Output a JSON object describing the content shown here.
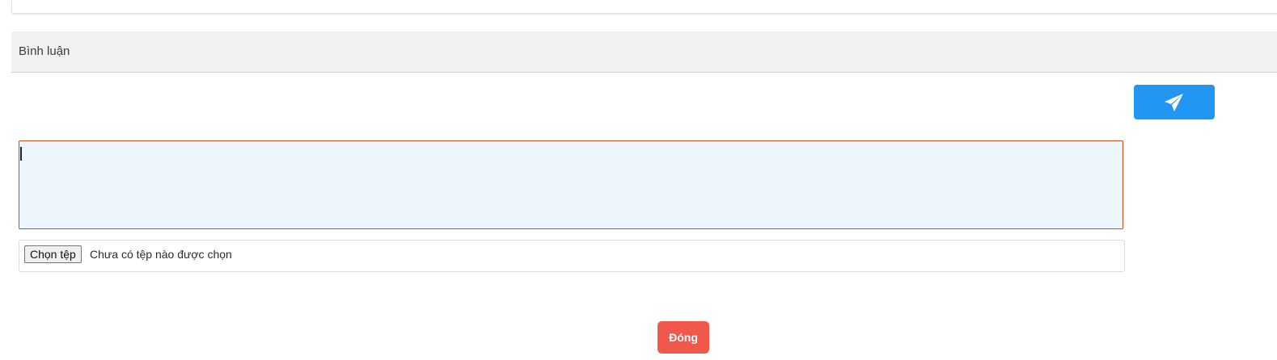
{
  "comments": {
    "title": "Bình luận",
    "send_icon": "paper-plane-icon",
    "input_value": "",
    "file_picker": {
      "button_label": "Chọn tệp",
      "status_text": "Chưa có tệp nào được chọn"
    }
  },
  "footer": {
    "close_label": "Đóng"
  },
  "colors": {
    "send_button": "#2196f3",
    "close_button": "#f2574c",
    "input_background": "#eef6fd",
    "input_border_focus": "#d9480f",
    "header_background": "#f1f1f1"
  }
}
